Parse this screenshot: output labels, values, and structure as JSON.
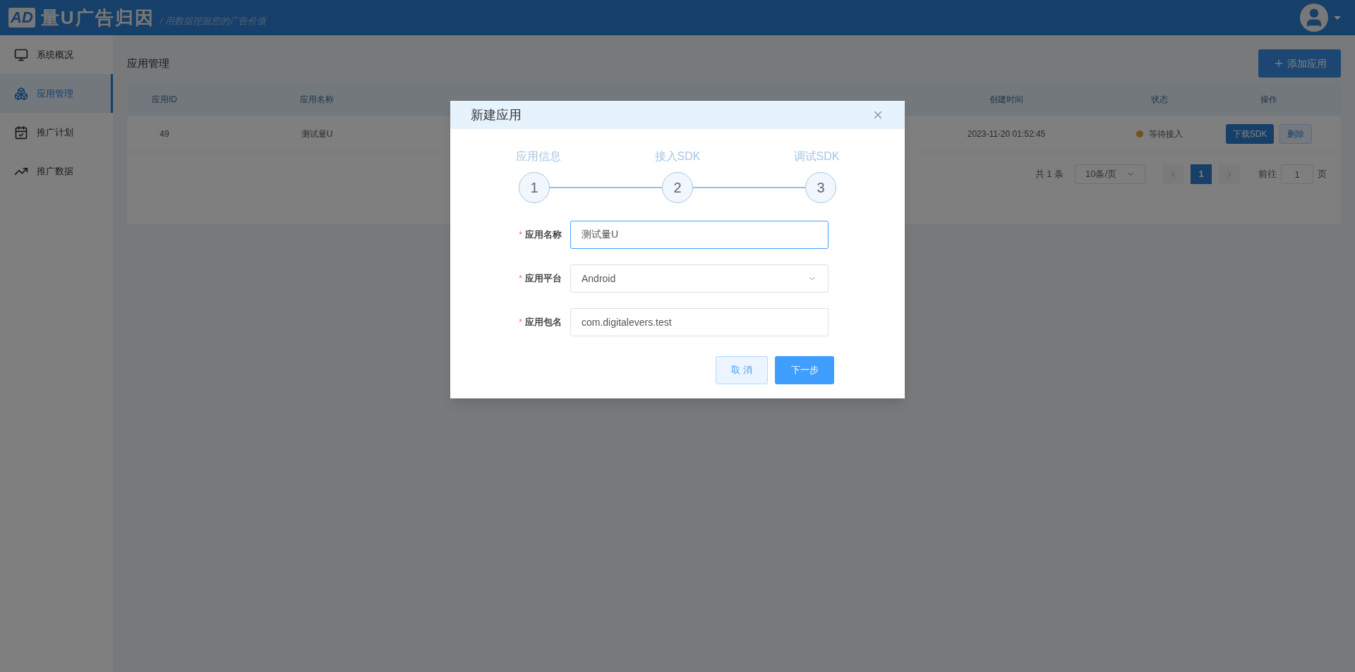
{
  "header": {
    "logo_mark": "AD",
    "logo_text": "量U广告归因",
    "tagline": "/ 用数据挖掘您的广告价值"
  },
  "sidebar": {
    "items": [
      {
        "label": "系统概况",
        "selected": false
      },
      {
        "label": "应用管理",
        "selected": true
      },
      {
        "label": "推广计划",
        "selected": false
      },
      {
        "label": "推广数据",
        "selected": false
      }
    ]
  },
  "page": {
    "title": "应用管理",
    "add_button": "添加应用"
  },
  "table": {
    "columns": [
      "应用ID",
      "应用名称",
      "创建时间",
      "状态",
      "操作"
    ],
    "rows": [
      {
        "id": "49",
        "name": "测试量U",
        "created": "2023-11-20 01:52:45",
        "status": "等待接入",
        "color": "#73511e",
        "actions": [
          "下载SDK",
          "删除"
        ]
      }
    ]
  },
  "pagination": {
    "total": "共 1 条",
    "page_size": "10条/页",
    "pages": [
      {
        "label": "1",
        "selected": true
      }
    ],
    "goto_prefix": "前往",
    "goto_value": "1",
    "goto_suffix": "页"
  },
  "modal": {
    "title": "新建应用",
    "steps": [
      {
        "label": "应用信息",
        "number": "1"
      },
      {
        "label": "接入SDK",
        "number": "2"
      },
      {
        "label": "调试SDK",
        "number": "3"
      }
    ],
    "fields": [
      {
        "label": "应用名称",
        "kind": "input",
        "value": "测试量U",
        "required_mark": "*",
        "focused": true
      },
      {
        "label": "应用平台",
        "kind": "select",
        "value": "Android",
        "required_mark": "*",
        "focused": false
      },
      {
        "label": "应用包名",
        "kind": "input",
        "value": "com.digitalevers.test",
        "required_mark": "*",
        "focused": false
      }
    ],
    "buttons": [
      {
        "label": "取 消",
        "kind": "secondary"
      },
      {
        "label": "下一步",
        "kind": "primary"
      }
    ]
  }
}
